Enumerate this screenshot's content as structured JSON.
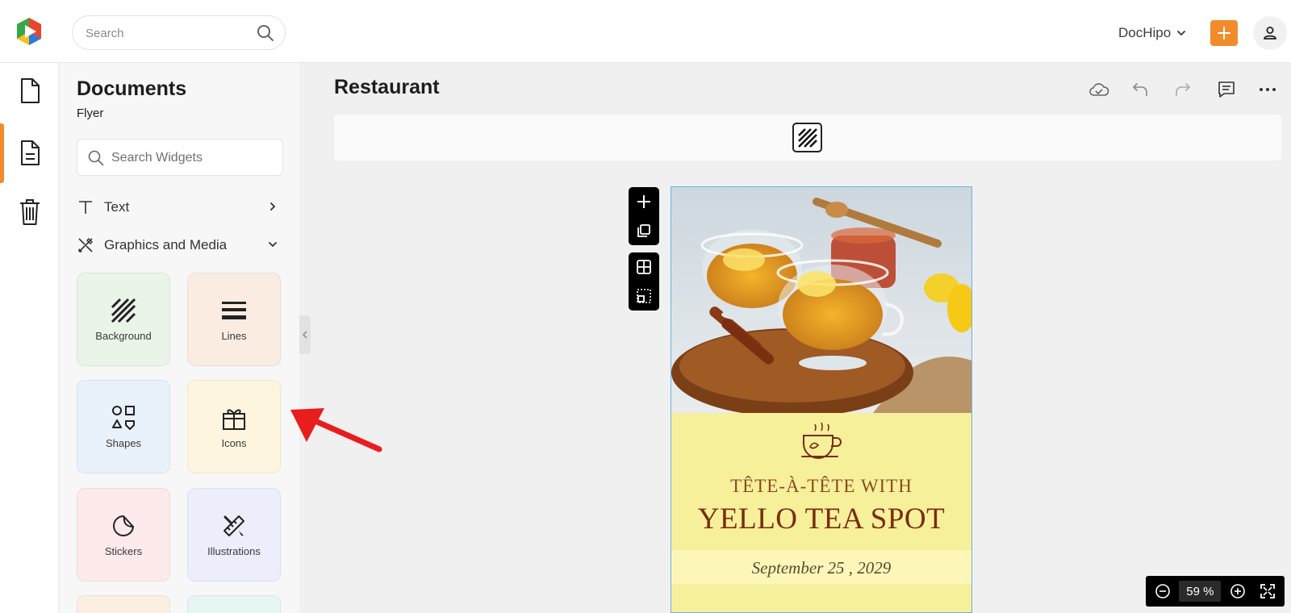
{
  "header": {
    "search_placeholder": "Search",
    "brand": "DocHipo",
    "accent_color": "#f28b2c",
    "icons": [
      "app-logo-icon",
      "search-icon",
      "chevron-down-icon",
      "plus-icon",
      "user-icon"
    ]
  },
  "rail": {
    "items": [
      {
        "name": "documents",
        "icon": "document-icon"
      },
      {
        "name": "widgets",
        "icon": "document-lines-icon",
        "active": true
      },
      {
        "name": "trash",
        "icon": "trash-icon"
      }
    ]
  },
  "panel": {
    "title": "Documents",
    "subtitle": "Flyer",
    "search_placeholder": "Search Widgets",
    "sections": [
      {
        "label": "Text",
        "icon": "text-icon",
        "state": "collapsed"
      },
      {
        "label": "Graphics and Media",
        "icon": "graphics-icon",
        "state": "expanded"
      }
    ],
    "tiles": [
      {
        "label": "Background",
        "icon": "stripes-icon",
        "color": "#eaf4e8"
      },
      {
        "label": "Lines",
        "icon": "lines-icon",
        "color": "#fbece2"
      },
      {
        "label": "Shapes",
        "icon": "shapes-icon",
        "color": "#e9f1fb"
      },
      {
        "label": "Icons",
        "icon": "gift-icon",
        "color": "#fdf5de"
      },
      {
        "label": "Stickers",
        "icon": "sticker-icon",
        "color": "#fdeaea"
      },
      {
        "label": "Illustrations",
        "icon": "pen-ruler-icon",
        "color": "#eceefb"
      }
    ]
  },
  "canvas": {
    "doc_title": "Restaurant",
    "toolbar_icons": [
      "cloud-check-icon",
      "undo-icon",
      "redo-icon",
      "comment-icon",
      "more-icon"
    ],
    "floating_tools": [
      "add-icon",
      "duplicate-icon",
      "grid-icon",
      "select-icon"
    ]
  },
  "flyer": {
    "icon": "tea-cup-icon",
    "subhead": "TÊTE-À-TÊTE WITH",
    "headline": "YELLO TEA SPOT",
    "date": "September 25 , 2029",
    "colors": {
      "background": "#f7f09a",
      "band": "#fcf7b8",
      "text": "#7a2c10"
    }
  },
  "zoom": {
    "value": "59",
    "unit": "%"
  },
  "annotation": {
    "arrow_color": "#e81d1d",
    "points_to": "Icons"
  }
}
